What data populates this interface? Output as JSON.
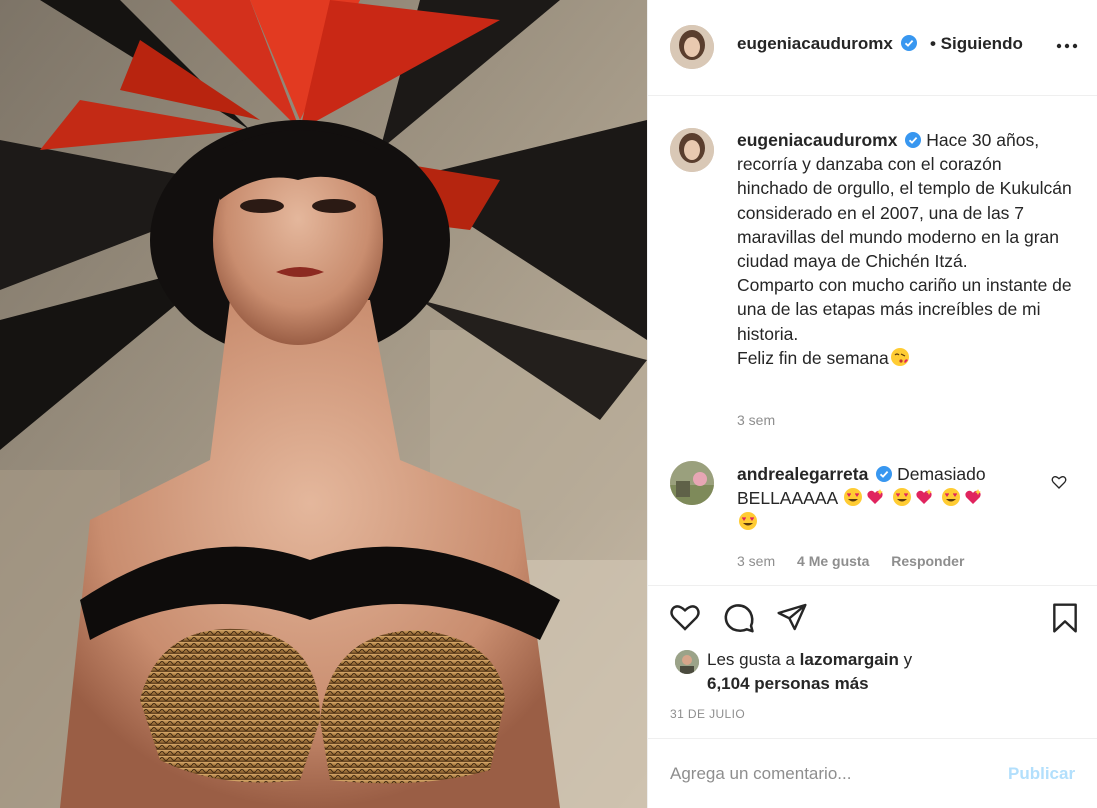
{
  "post": {
    "username": "eugeniacauduromx",
    "follow_status": "• Siguiendo",
    "caption": "Hace 30 años, recorría y danzaba con el corazón hinchado de orgullo, el templo de Kukulcán considerado en el 2007, una de las 7 maravillas del mundo moderno en la gran ciudad maya de Chichén Itzá.",
    "caption_line2": "Comparto con mucho cariño un instante de una de las etapas más increíbles de mi historia.",
    "caption_line3": "Feliz fin de semana",
    "caption_time": "3 sem"
  },
  "comment": {
    "username": "andrealegarreta",
    "text": "Demasiado BELLAAAAA",
    "time": "3 sem",
    "likes": "4 Me gusta",
    "reply": "Responder"
  },
  "likes": {
    "prefix": "Les gusta a",
    "user": "lazomargain",
    "conj": "y",
    "others": "6,104 personas más"
  },
  "date": "31 DE JULIO",
  "comment_bar": {
    "placeholder": "Agrega un comentario...",
    "publish": "Publicar"
  },
  "icons": {
    "verified": "verified-badge-icon",
    "more": "more-options-icon",
    "heart": "heart-icon",
    "comment": "comment-icon",
    "share": "share-icon",
    "save": "bookmark-icon"
  },
  "colors": {
    "verified": "#3897f0",
    "link_blue_disabled": "#b2dffc",
    "muted": "#8e8e8e",
    "text": "#262626"
  }
}
